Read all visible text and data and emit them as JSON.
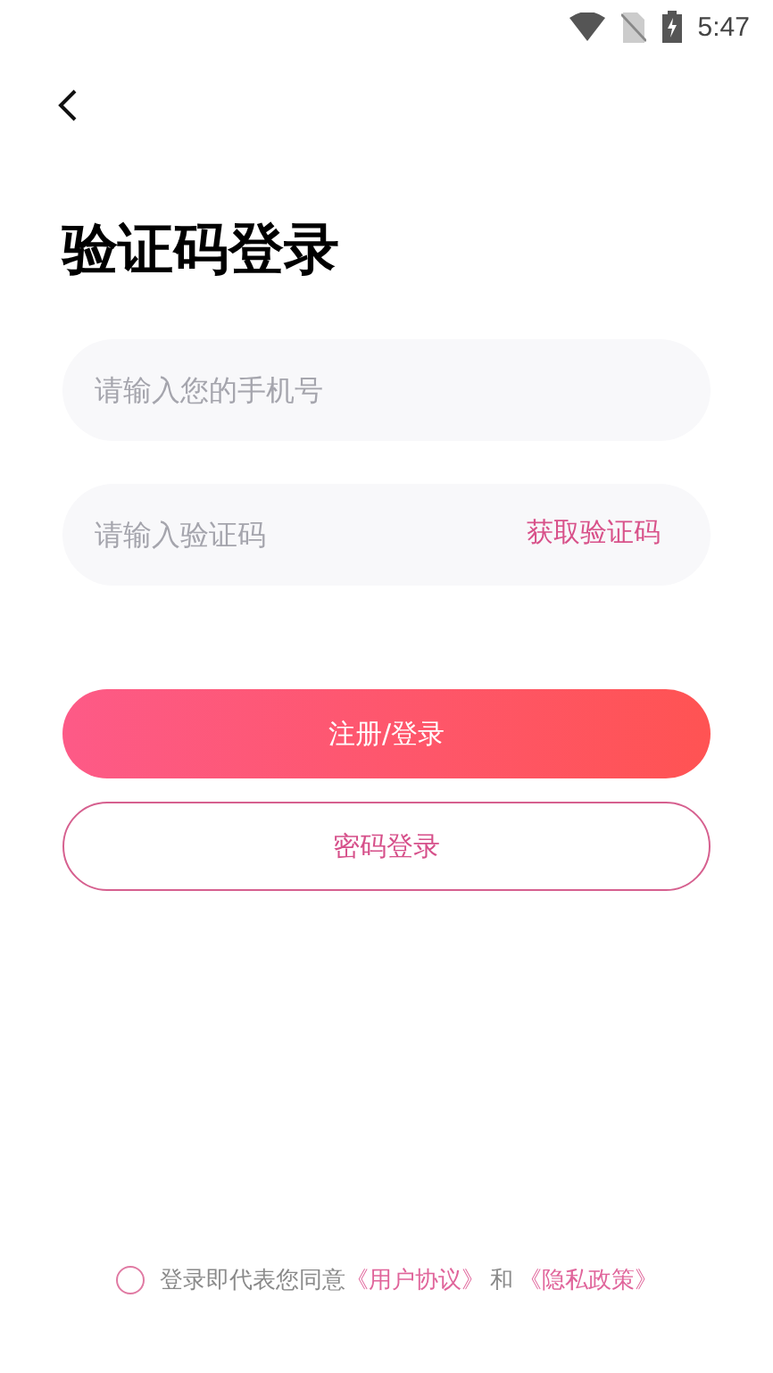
{
  "status_bar": {
    "time": "5:47"
  },
  "title": "验证码登录",
  "phone_field": {
    "placeholder": "请输入您的手机号"
  },
  "code_field": {
    "placeholder": "请输入验证码",
    "action": "获取验证码"
  },
  "buttons": [
    {
      "label": "注册/登录",
      "kind": "primary"
    },
    {
      "label": "密码登录",
      "kind": "outline"
    }
  ],
  "agreement": {
    "checked": false,
    "text": "登录即代表您同意",
    "user_agreement": "《用户协议》",
    "joiner": "和",
    "privacy_policy": "《隐私政策》"
  }
}
